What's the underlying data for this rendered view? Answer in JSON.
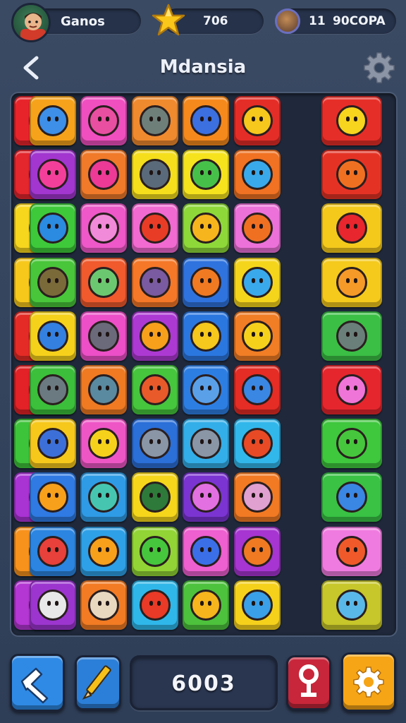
{
  "hud": {
    "player_label": "Ganos",
    "stars_value": "706",
    "level_value": "11",
    "level_name": "90COPA"
  },
  "header": {
    "title": "Mdansia"
  },
  "bottom": {
    "score_value": "6003"
  },
  "icons": {
    "back": "back-chevron-icon",
    "settings": "gear-icon",
    "star": "star-icon",
    "avatar": "avatar",
    "trophy": "trophy-icon",
    "hammer": "hammer-icon",
    "pencil": "pencil-icon",
    "hint": "key-icon",
    "settings_bottom": "gear-icon"
  },
  "board": {
    "rows": 10,
    "cols": 7,
    "tile_colors": [
      [
        "#e8242b",
        "#f6a31b",
        "#f04fc0",
        "#f08a2e",
        "#f6891c",
        "#e52d27",
        "#e62e28"
      ],
      [
        "#e4262d",
        "#a236cf",
        "#f07a2a",
        "#f5de1c",
        "#f6e31e",
        "#f07222",
        "#e43325"
      ],
      [
        "#f7d61e",
        "#3ec93a",
        "#ee58c8",
        "#f16ad1",
        "#8ed939",
        "#ec71d9",
        "#f4c91c"
      ],
      [
        "#f7c81c",
        "#49c63a",
        "#f05a2d",
        "#f57828",
        "#2f73de",
        "#f5d51c",
        "#f5ca1c"
      ],
      [
        "#e52b26",
        "#f6d11b",
        "#ec4fc7",
        "#ad39d3",
        "#2b77e0",
        "#f17d25",
        "#3bbf45"
      ],
      [
        "#e22226",
        "#3cbf3b",
        "#ef7a22",
        "#46c63c",
        "#2d7ee3",
        "#e52c25",
        "#e5262d"
      ],
      [
        "#3ec43a",
        "#f6c81c",
        "#ee56c6",
        "#2b6fd8",
        "#33aee8",
        "#32b7eb",
        "#3fc73e"
      ],
      [
        "#aa33d4",
        "#2f7ae3",
        "#2f9be6",
        "#f5d61b",
        "#7b34d2",
        "#f27a23",
        "#39c244"
      ],
      [
        "#f7921d",
        "#2b85e1",
        "#2ea0e7",
        "#92d435",
        "#ee5fd0",
        "#a735d1",
        "#f07be0"
      ],
      [
        "#b436d3",
        "#9c35cf",
        "#f27b23",
        "#2fb7ea",
        "#4dc23c",
        "#f6d11c",
        "#c7c62a"
      ]
    ],
    "glyph_colors": [
      [
        "#39c23a",
        "#3d8fe8",
        "#e84fa0",
        "#6e7f7a",
        "#3c6fe0",
        "#f6c71c",
        "#f7d41e"
      ],
      [
        "#7ec0ec",
        "#f33f9a",
        "#ec3a96",
        "#5a6a7a",
        "#47c04a",
        "#3aa9ec",
        "#f07022"
      ],
      [
        "#f6b51c",
        "#2a8be0",
        "#f18ad8",
        "#e83c26",
        "#f6b51c",
        "#f07022",
        "#e8262d"
      ],
      [
        "#f5a71c",
        "#7a6a3a",
        "#6cc870",
        "#7a5aa0",
        "#f07a22",
        "#3aa9ec",
        "#f59a28"
      ],
      [
        "#f05a2a",
        "#3380e0",
        "#6a6a7a",
        "#f6a01c",
        "#f6c71c",
        "#f6d11c",
        "#6a7f7a"
      ],
      [
        "#7a8aa0",
        "#6a7a80",
        "#5a8aa0",
        "#e85a2a",
        "#5aa0e8",
        "#3a86e3",
        "#f075d8"
      ],
      [
        "#2f80e0",
        "#3d6fd8",
        "#f6d11c",
        "#8a96a6",
        "#8a96a6",
        "#e84a26",
        "#46c63c"
      ],
      [
        "#f05a2a",
        "#f6a01c",
        "#46c6b0",
        "#2e7a3a",
        "#e270e0",
        "#e0a0d0",
        "#3a86e3"
      ],
      [
        "#46c63c",
        "#e8403a",
        "#f6a01c",
        "#46c63c",
        "#3a6fe8",
        "#f07a22",
        "#f05a2a"
      ],
      [
        "#ee5cc0",
        "#e8e8e8",
        "#e8d8c0",
        "#e83a26",
        "#f6b51c",
        "#3aa0e8",
        "#5ab8e8"
      ]
    ]
  }
}
